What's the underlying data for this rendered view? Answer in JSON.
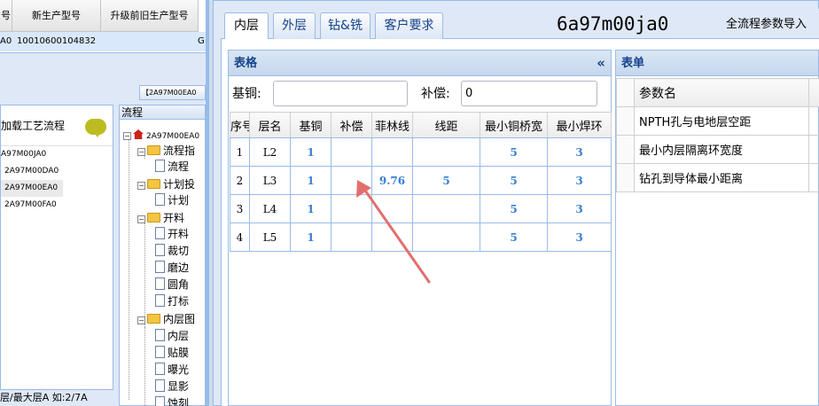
{
  "bg": {
    "grid_headers": [
      "号",
      "新生产型号",
      "升级前旧生产型号"
    ],
    "selected_row": {
      "col0": "A0",
      "col1": "10010600104832",
      "col2": "G"
    },
    "tab_label": "【2A97M00EA0",
    "left_header": "加载工艺流程",
    "models": [
      "A97M00JA0",
      "2A97M00DA0",
      "2A97M00EA0",
      "2A97M00FA0"
    ],
    "flow_title": "流程",
    "tree": {
      "root": "2A97M00EA0",
      "nodes": [
        "流程指",
        "流程",
        "计划投",
        "计划",
        "开料",
        "开料",
        "裁切",
        "磨边",
        "圆角",
        "打标",
        "内层图",
        "内层",
        "贴膜",
        "曝光",
        "显影",
        "蚀刻"
      ]
    },
    "bottom_text": "层/最大层A 如:2/7A"
  },
  "modal": {
    "tabs": [
      "内层",
      "外层",
      "钻&铣",
      "客户要求"
    ],
    "active_tab": 0,
    "code": "6a97m00ja0",
    "import_label": "全流程参数导入",
    "left_panel": {
      "title": "表格",
      "collapse_icon": "«",
      "fields": {
        "base_copper_label": "基铜:",
        "base_copper_value": "",
        "compensation_label": "补偿:",
        "compensation_value": "0"
      },
      "columns": [
        "序号",
        "层名",
        "基铜",
        "补偿",
        "菲林线",
        "线距",
        "最小铜桥宽",
        "最小焊环"
      ],
      "rows": [
        [
          "1",
          "L2",
          "1",
          "",
          "",
          "",
          "5",
          "3"
        ],
        [
          "2",
          "L3",
          "1",
          "",
          "9.76",
          "5",
          "5",
          "3"
        ],
        [
          "3",
          "L4",
          "1",
          "",
          "",
          "",
          "5",
          "3"
        ],
        [
          "4",
          "L5",
          "1",
          "",
          "",
          "",
          "5",
          "3"
        ]
      ]
    },
    "right_panel": {
      "title": "表单",
      "column": "参数名",
      "rows": [
        "NPTH孔与电地层空距",
        "最小内层隔离环宽度",
        "钻孔到导体最小距离"
      ]
    },
    "annotation_color": "#e26f6f"
  }
}
